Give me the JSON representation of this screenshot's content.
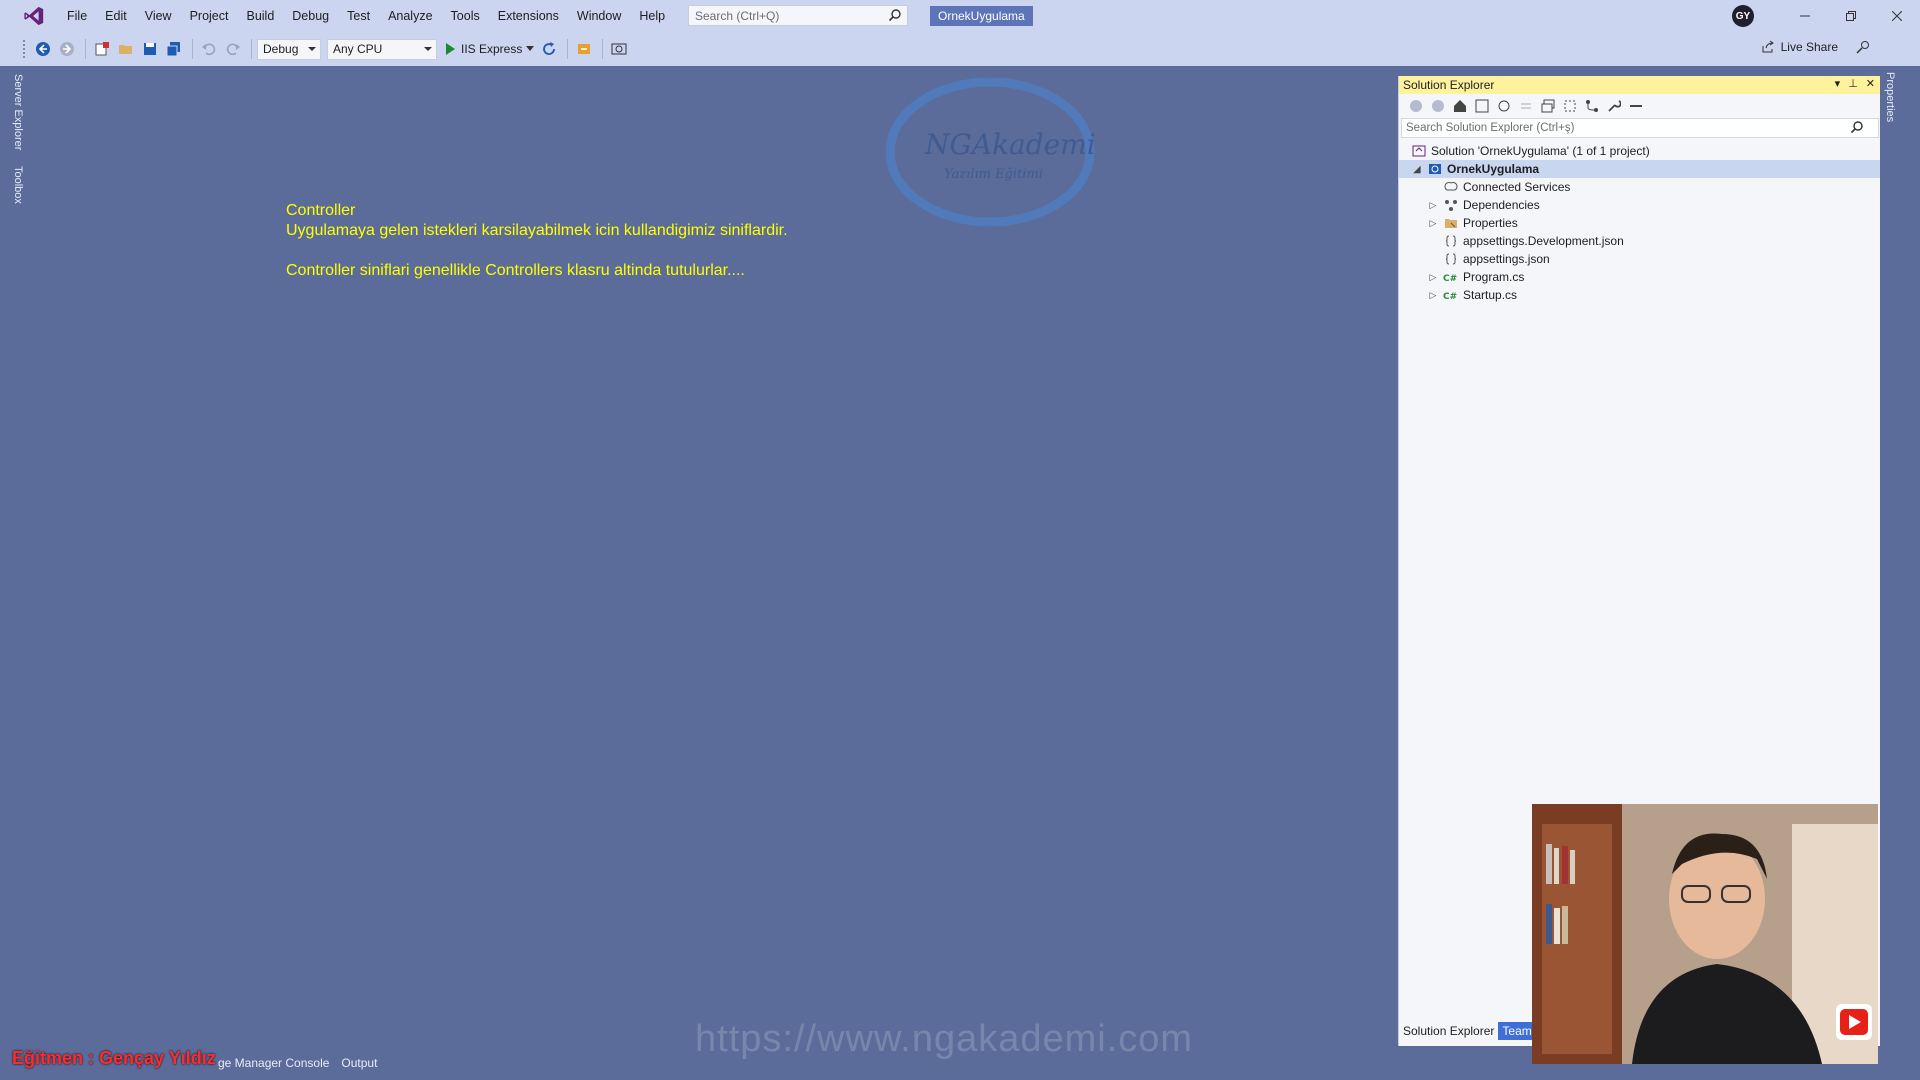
{
  "menu": [
    "File",
    "Edit",
    "View",
    "Project",
    "Build",
    "Debug",
    "Test",
    "Analyze",
    "Tools",
    "Extensions",
    "Window",
    "Help"
  ],
  "search": {
    "placeholder": "Search (Ctrl+Q)"
  },
  "solution_name": "OrnekUygulama",
  "avatar_initials": "GY",
  "toolbar": {
    "configuration": "Debug",
    "platform": "Any CPU",
    "run_target": "IIS Express",
    "live_share": "Live Share"
  },
  "left_tabs": [
    "Server Explorer",
    "Toolbox"
  ],
  "right_tabs": [
    "Properties"
  ],
  "editor_notes": {
    "line1": "Controller",
    "line2": "Uygulamaya gelen istekleri karsilayabilmek icin kullandigimiz siniflardir.",
    "line3": "Controller siniflari genellikle Controllers klasru altinda tutulurlar...."
  },
  "watermark": {
    "logo_title": "NGAkademi",
    "logo_subtitle": "Yazılım Eğitimi",
    "url": "https://www.ngakademi.com"
  },
  "solution_explorer": {
    "title": "Solution Explorer",
    "search_placeholder": "Search Solution Explorer (Ctrl+ş)",
    "tree": [
      {
        "label": "Solution 'OrnekUygulama' (1 of 1 project)",
        "icon": "solution-icon",
        "depth": 0,
        "expander": ""
      },
      {
        "label": "OrnekUygulama",
        "icon": "web-project-icon",
        "depth": 0,
        "expander": "◢",
        "selected": true
      },
      {
        "label": "Connected Services",
        "icon": "connected-services-icon",
        "depth": 1,
        "expander": ""
      },
      {
        "label": "Dependencies",
        "icon": "dependencies-icon",
        "depth": 1,
        "expander": "▷"
      },
      {
        "label": "Properties",
        "icon": "properties-folder-icon",
        "depth": 1,
        "expander": "▷"
      },
      {
        "label": "appsettings.Development.json",
        "icon": "json-file-icon",
        "depth": 1,
        "expander": ""
      },
      {
        "label": "appsettings.json",
        "icon": "json-file-icon",
        "depth": 1,
        "expander": ""
      },
      {
        "label": "Program.cs",
        "icon": "csharp-file-icon",
        "depth": 1,
        "expander": "▷"
      },
      {
        "label": "Startup.cs",
        "icon": "csharp-file-icon",
        "depth": 1,
        "expander": "▷"
      }
    ],
    "bottom_tabs": [
      "Solution Explorer",
      "Team"
    ]
  },
  "bottom_panel_tabs": [
    "ge Manager Console",
    "Output"
  ],
  "instructor_label": "Eğitmen : Gençay Yıldız",
  "colors": {
    "editor_background": "#5b6b9a",
    "chrome": "#ccd5f0",
    "note_text": "#ffff00",
    "panel_header_active": "#fff29d",
    "instructor_text": "#ff2a2a"
  }
}
